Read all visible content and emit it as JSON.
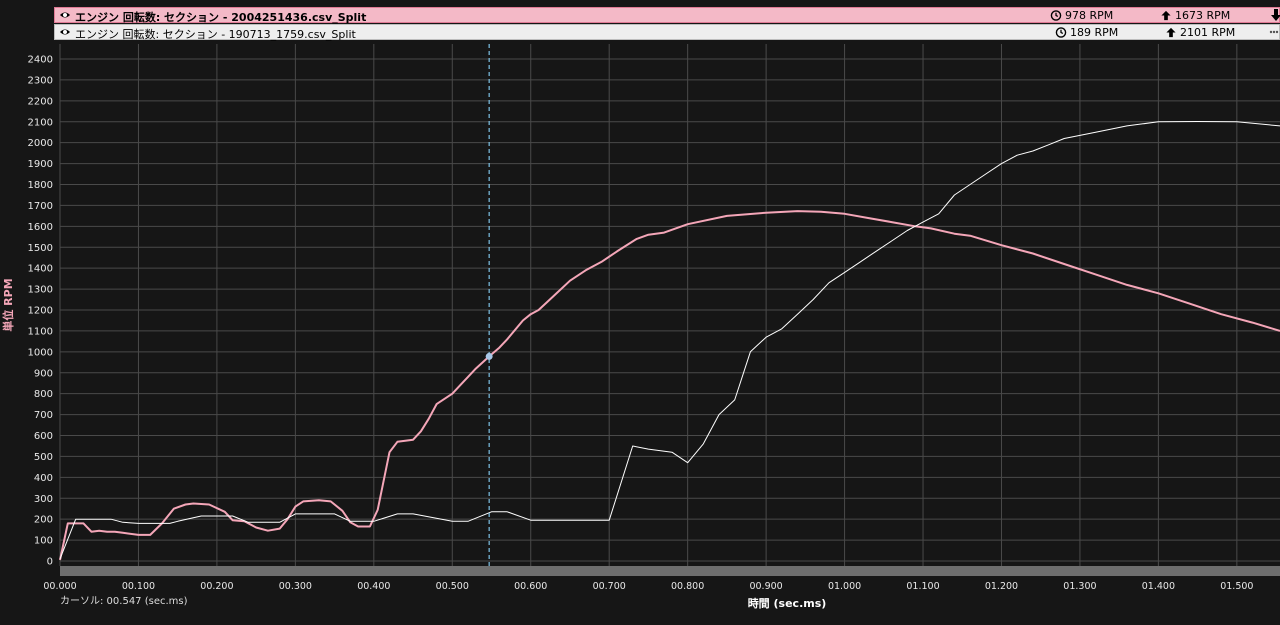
{
  "legend": [
    {
      "icon": "eye-icon",
      "name": "エンジン 回転数: セクション - 2004251436.csv_Split",
      "min_label": "978 RPM",
      "max_label": "1673 RPM",
      "color": "#f4b9c7"
    },
    {
      "icon": "eye-icon",
      "name": "エンジン 回転数: セクション - 190713_1759.csv_Split",
      "min_label": "189 RPM",
      "max_label": "2101 RPM",
      "color": "#eeeeee"
    }
  ],
  "cursor_label": "カーソル: 00.547 (sec.ms)",
  "chart_data": {
    "type": "line",
    "xlabel": "時間 (sec.ms)",
    "ylabel": "単位 RPM",
    "xlim": [
      0,
      1.555
    ],
    "ylim": [
      0,
      2400
    ],
    "x_ticks": [
      0,
      0.1,
      0.2,
      0.3,
      0.4,
      0.5,
      0.6,
      0.7,
      0.8,
      0.9,
      1.0,
      1.1,
      1.2,
      1.3,
      1.4,
      1.5
    ],
    "x_tick_labels": [
      "00.000",
      "00.100",
      "00.200",
      "00.300",
      "00.400",
      "00.500",
      "00.600",
      "00.700",
      "00.800",
      "00.900",
      "01.000",
      "01.100",
      "01.200",
      "01.300",
      "01.400",
      "01.500"
    ],
    "y_ticks": [
      0,
      100,
      200,
      300,
      400,
      500,
      600,
      700,
      800,
      900,
      1000,
      1100,
      1200,
      1300,
      1400,
      1500,
      1600,
      1700,
      1800,
      1900,
      2000,
      2100,
      2200,
      2300,
      2400
    ],
    "cursor_x": 0.547,
    "cursor_y": 978,
    "grid": true,
    "series": [
      {
        "color": "#f4a6b8",
        "width": 2,
        "x": [
          0,
          0.01,
          0.03,
          0.04,
          0.05,
          0.06,
          0.07,
          0.08,
          0.1,
          0.115,
          0.13,
          0.145,
          0.16,
          0.17,
          0.19,
          0.21,
          0.22,
          0.235,
          0.25,
          0.265,
          0.28,
          0.29,
          0.3,
          0.31,
          0.33,
          0.345,
          0.36,
          0.37,
          0.38,
          0.395,
          0.405,
          0.42,
          0.43,
          0.45,
          0.46,
          0.47,
          0.48,
          0.5,
          0.51,
          0.52,
          0.53,
          0.547,
          0.56,
          0.57,
          0.59,
          0.6,
          0.61,
          0.63,
          0.65,
          0.67,
          0.69,
          0.71,
          0.735,
          0.75,
          0.77,
          0.8,
          0.85,
          0.9,
          0.94,
          0.97,
          1.0,
          1.03,
          1.06,
          1.09,
          1.11,
          1.14,
          1.16,
          1.2,
          1.24,
          1.28,
          1.32,
          1.36,
          1.4,
          1.44,
          1.48,
          1.52,
          1.555
        ],
        "y": [
          5,
          180,
          180,
          140,
          145,
          140,
          140,
          135,
          125,
          125,
          180,
          250,
          270,
          275,
          270,
          235,
          195,
          190,
          160,
          145,
          155,
          200,
          260,
          285,
          290,
          285,
          240,
          185,
          165,
          165,
          245,
          520,
          570,
          580,
          620,
          680,
          750,
          800,
          840,
          880,
          920,
          978,
          1020,
          1060,
          1150,
          1180,
          1200,
          1270,
          1340,
          1390,
          1430,
          1480,
          1540,
          1560,
          1570,
          1610,
          1650,
          1665,
          1673,
          1670,
          1660,
          1640,
          1620,
          1600,
          1590,
          1565,
          1555,
          1510,
          1470,
          1420,
          1370,
          1320,
          1280,
          1230,
          1180,
          1140,
          1100
        ]
      },
      {
        "color": "#ffffff",
        "width": 1,
        "x": [
          0,
          0.02,
          0.04,
          0.065,
          0.08,
          0.1,
          0.14,
          0.15,
          0.18,
          0.22,
          0.24,
          0.28,
          0.3,
          0.32,
          0.35,
          0.37,
          0.4,
          0.43,
          0.45,
          0.5,
          0.52,
          0.55,
          0.57,
          0.6,
          0.7,
          0.73,
          0.75,
          0.78,
          0.8,
          0.82,
          0.84,
          0.86,
          0.88,
          0.9,
          0.92,
          0.94,
          0.96,
          0.98,
          1.0,
          1.02,
          1.04,
          1.06,
          1.08,
          1.1,
          1.12,
          1.14,
          1.16,
          1.18,
          1.2,
          1.22,
          1.24,
          1.26,
          1.28,
          1.32,
          1.36,
          1.4,
          1.45,
          1.5,
          1.555
        ],
        "y": [
          10,
          200,
          200,
          200,
          185,
          180,
          180,
          190,
          215,
          215,
          185,
          185,
          225,
          225,
          225,
          190,
          190,
          225,
          225,
          190,
          190,
          235,
          235,
          195,
          195,
          550,
          535,
          520,
          470,
          560,
          700,
          770,
          1000,
          1070,
          1110,
          1180,
          1250,
          1330,
          1380,
          1430,
          1480,
          1530,
          1580,
          1620,
          1660,
          1750,
          1800,
          1850,
          1900,
          1940,
          1960,
          1990,
          2020,
          2050,
          2080,
          2100,
          2101,
          2100,
          2080
        ]
      }
    ]
  }
}
